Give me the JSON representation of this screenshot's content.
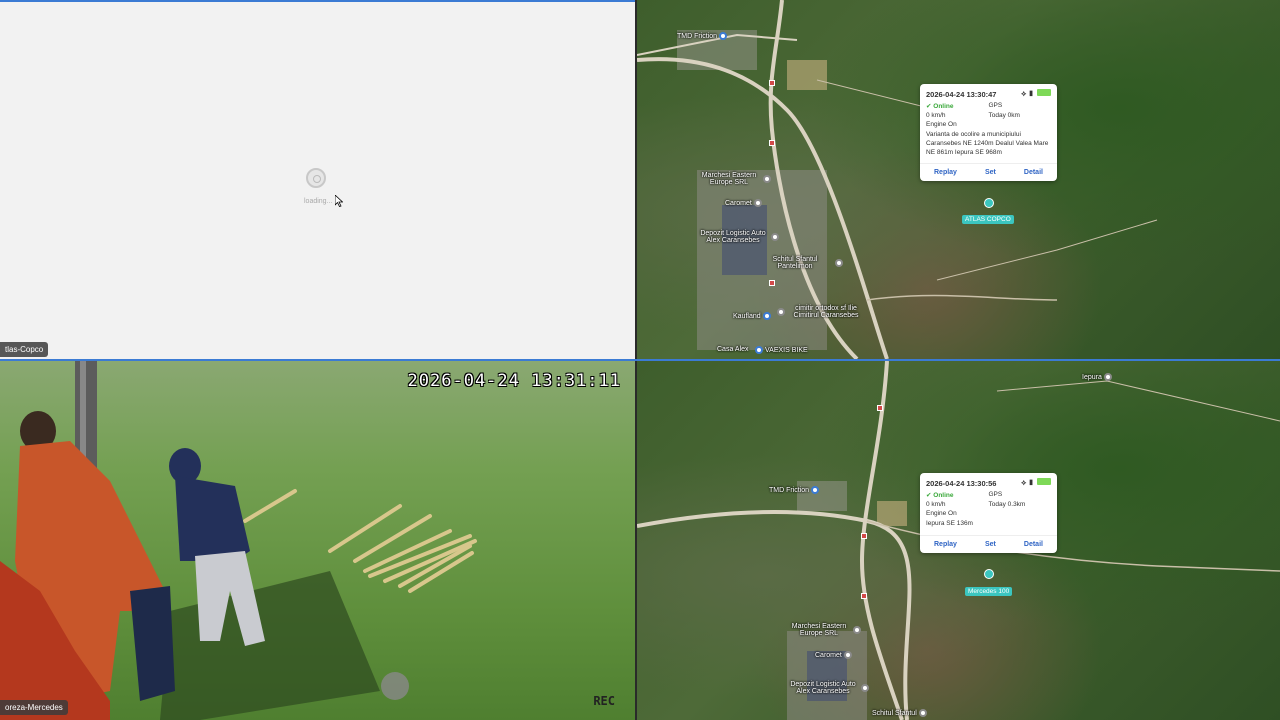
{
  "top_left": {
    "loading_text": "loading...",
    "camera_label": "tlas-Copco"
  },
  "bottom_left": {
    "timestamp": "2026-04-24 13:31:11",
    "rec_label": "REC",
    "camera_label": "oreza-Mercedes"
  },
  "map_top": {
    "popup": {
      "datetime": "2026-04-24 13:30:47",
      "status": "Online",
      "gps_label": "GPS",
      "speed": "0 km/h",
      "today": "Today 0km",
      "engine": "Engine On",
      "address": "Varianta de ocolire a municipiului Caransebes NE 1240m Dealul Valea Mare NE 861m Iepura SE 968m",
      "actions": [
        "Replay",
        "Set",
        "Detail"
      ]
    },
    "vehicle_label": "ATLAS COPCO",
    "pois": [
      "TMD Friction",
      "Marchesi Eastern Europe SRL",
      "Caromet",
      "Depozit Logistic Auto Alex Caransebes",
      "Schitul Sfantul Pantelimon",
      "cimitir ortodox sf Ilie Cimitirul Caransebes",
      "Kaufland",
      "Casa Alex",
      "VAEXIS BIKE"
    ]
  },
  "map_bottom": {
    "popup": {
      "datetime": "2026-04-24 13:30:56",
      "status": "Online",
      "gps_label": "GPS",
      "speed": "0 km/h",
      "today": "Today 0.3km",
      "engine": "Engine On",
      "address": "Iepura SE 136m",
      "actions": [
        "Replay",
        "Set",
        "Detail"
      ]
    },
    "vehicle_label": "Mercedes 100",
    "pois": [
      "Iepura",
      "TMD Friction",
      "Marchesi Eastern Europe SRL",
      "Caromet",
      "Depozit Logistic Auto Alex Caransebes",
      "Schitul Sfantul"
    ]
  }
}
